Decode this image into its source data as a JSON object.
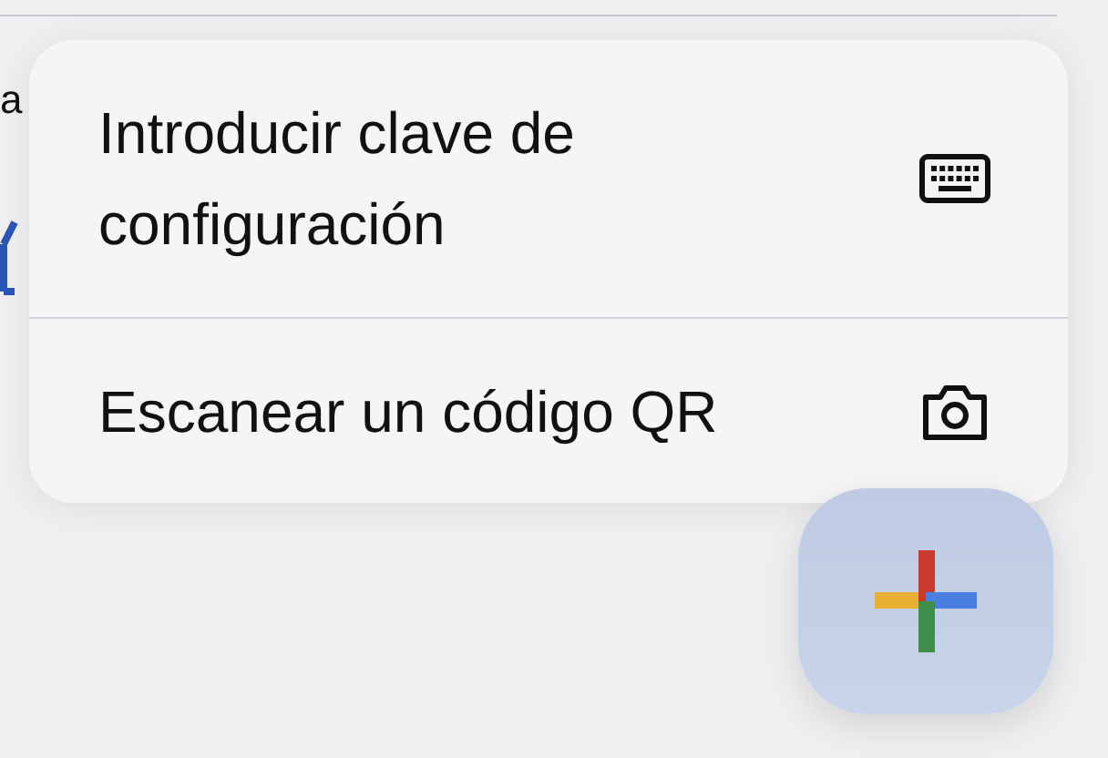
{
  "background": {
    "text_fragment": "a"
  },
  "menu": {
    "items": [
      {
        "label": "Introducir clave de configuración",
        "kind": "keyboard"
      },
      {
        "label": "Escanear un código QR",
        "kind": "camera"
      }
    ]
  },
  "fab": {
    "kind": "add"
  }
}
